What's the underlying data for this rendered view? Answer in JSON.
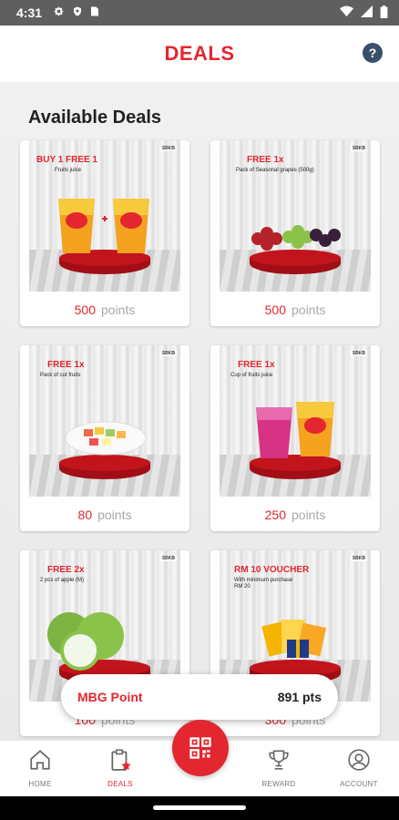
{
  "status_bar": {
    "time": "4:31"
  },
  "header": {
    "title": "DEALS",
    "help_label": "?"
  },
  "section_title": "Available Deals",
  "deals": [
    {
      "headline": "BUY 1 FREE 1",
      "subtitle": "Fruits juice",
      "points": "500",
      "points_unit": "points",
      "image": "juice-cups"
    },
    {
      "headline": "FREE 1x",
      "subtitle": "Pack of Seasonal grapes (500g)",
      "points": "500",
      "points_unit": "points",
      "image": "grapes"
    },
    {
      "headline": "FREE 1x",
      "subtitle": "Pack of cut fruits",
      "points": "80",
      "points_unit": "points",
      "image": "cut-fruit-plate"
    },
    {
      "headline": "FREE 1x",
      "subtitle": "Cup of fruits juice",
      "points": "250",
      "points_unit": "points",
      "image": "juice-cups"
    },
    {
      "headline": "FREE 2x",
      "subtitle": "2 pcs of apple (M)",
      "points": "100",
      "points_unit": "points",
      "image": "green-apples"
    },
    {
      "headline": "RM 10 VOUCHER",
      "subtitle": "With minimum purchase RM 20",
      "points": "300",
      "points_unit": "points",
      "image": "voucher-gift"
    }
  ],
  "mbg_point": {
    "label": "MBG Point",
    "value": "891 pts"
  },
  "nav": {
    "home": "HOME",
    "deals": "DEALS",
    "reward": "REWARD",
    "account": "ACCOUNT"
  },
  "colors": {
    "accent": "#e3262f",
    "podium": "#c2141c",
    "help": "#3b4f6b"
  }
}
